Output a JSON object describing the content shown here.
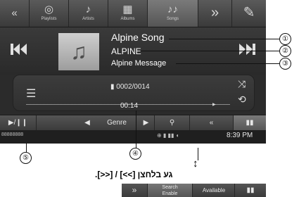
{
  "topbar": {
    "items": [
      {
        "icon": "«",
        "label": ""
      },
      {
        "icon": "◎",
        "label": "Playlists"
      },
      {
        "icon": "♪",
        "label": "Artists"
      },
      {
        "icon": "▦",
        "label": "Albums"
      },
      {
        "icon": "♪♪",
        "label": "Songs"
      },
      {
        "icon": "»",
        "label": ""
      },
      {
        "icon": "✎",
        "label": ""
      }
    ]
  },
  "now_playing": {
    "song": "Alpine Song",
    "artist": "ALPINE",
    "album": "Alpine Message"
  },
  "track": {
    "number": "▮ 0002/0014",
    "elapsed": "00:14"
  },
  "controls": {
    "play_pause": "▶/❙❙",
    "prev": "◀",
    "genre": "Genre",
    "next": "▶",
    "search": "🔍",
    "back": "«",
    "mode": "▮▮"
  },
  "status": {
    "left": "88888888",
    "icons": "⊕ ▮ ▮▮ ◖",
    "time": "8:39 PM"
  },
  "callouts": [
    "①",
    "②",
    "③",
    "④",
    "⑤"
  ],
  "note": "גע בלחצן [>>] / [<<].",
  "strip": {
    "btn1": "»",
    "btn2_line1": "Search",
    "btn2_line2": "Enable",
    "btn3": "Available",
    "btn4": "▮▮"
  }
}
